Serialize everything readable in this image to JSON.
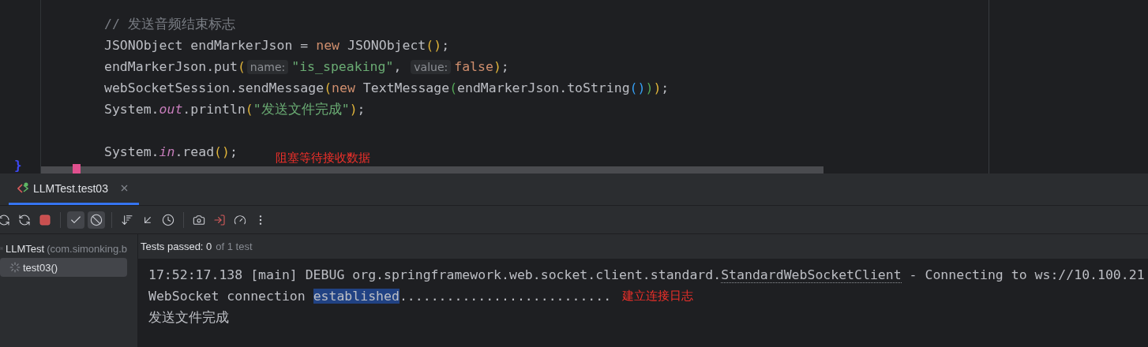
{
  "editor": {
    "gutter_brace": "}",
    "code_lines": [
      {
        "kind": "code",
        "tokens": [
          {
            "kind": "comment",
            "text": "// 发送音频结束标志"
          }
        ]
      },
      {
        "kind": "code",
        "tokens": [
          {
            "kind": "plain",
            "text": "JSONObject endMarkerJson = "
          },
          {
            "kind": "keyword",
            "text": "new"
          },
          {
            "kind": "plain",
            "text": " JSONObject"
          },
          {
            "kind": "paren1",
            "text": "()"
          },
          {
            "kind": "plain",
            "text": ";"
          }
        ]
      },
      {
        "kind": "code",
        "tokens": [
          {
            "kind": "plain",
            "text": "endMarkerJson.put"
          },
          {
            "kind": "paren1",
            "text": "("
          },
          {
            "kind": "hint",
            "text": "name:"
          },
          {
            "kind": "string",
            "text": "\"is_speaking\""
          },
          {
            "kind": "plain",
            "text": ", "
          },
          {
            "kind": "hint",
            "text": "value:"
          },
          {
            "kind": "keyword",
            "text": "false"
          },
          {
            "kind": "paren1",
            "text": ")"
          },
          {
            "kind": "plain",
            "text": ";"
          }
        ]
      },
      {
        "kind": "code",
        "tokens": [
          {
            "kind": "plain",
            "text": "webSocketSession.sendMessage"
          },
          {
            "kind": "paren1",
            "text": "("
          },
          {
            "kind": "keyword",
            "text": "new"
          },
          {
            "kind": "plain",
            "text": " TextMessage"
          },
          {
            "kind": "paren2",
            "text": "("
          },
          {
            "kind": "plain",
            "text": "endMarkerJson.toString"
          },
          {
            "kind": "paren3",
            "text": "()"
          },
          {
            "kind": "paren2",
            "text": ")"
          },
          {
            "kind": "paren1",
            "text": ")"
          },
          {
            "kind": "plain",
            "text": ";"
          }
        ]
      },
      {
        "kind": "code",
        "tokens": [
          {
            "kind": "plain",
            "text": "System."
          },
          {
            "kind": "field",
            "text": "out"
          },
          {
            "kind": "plain",
            "text": ".println"
          },
          {
            "kind": "paren1",
            "text": "("
          },
          {
            "kind": "string",
            "text": "\"发送文件完成\""
          },
          {
            "kind": "paren1",
            "text": ")"
          },
          {
            "kind": "plain",
            "text": ";"
          }
        ]
      },
      {
        "kind": "blank"
      },
      {
        "kind": "code",
        "tokens": [
          {
            "kind": "plain",
            "text": "System."
          },
          {
            "kind": "field",
            "text": "in"
          },
          {
            "kind": "plain",
            "text": ".read"
          },
          {
            "kind": "paren1",
            "text": "()"
          },
          {
            "kind": "plain",
            "text": ";"
          }
        ],
        "note": "阻塞等待接收数据"
      }
    ]
  },
  "run_panel": {
    "tabs": [
      {
        "label": "LLMTest.test03",
        "selected": true
      }
    ],
    "toolbar": {
      "left": [
        {
          "kind": "rerun-failed"
        },
        {
          "kind": "rerun"
        },
        {
          "kind": "stop"
        }
      ],
      "filters": [
        {
          "kind": "passed",
          "selected": true
        },
        {
          "kind": "ignored",
          "selected": true
        }
      ],
      "right": [
        {
          "kind": "sort"
        },
        {
          "kind": "collapse"
        },
        {
          "kind": "clock"
        },
        {
          "kind": "camera"
        },
        {
          "kind": "import"
        },
        {
          "kind": "gauge"
        },
        {
          "kind": "more"
        }
      ]
    },
    "tree": [
      {
        "label": "LLMTest",
        "detail": "(com.simonking.b",
        "selected": false,
        "children": [
          {
            "label": "test03()",
            "selected": true
          }
        ]
      }
    ],
    "status": {
      "passed": "Tests passed: 0",
      "total": "of 1 test"
    },
    "console": [
      {
        "segments": [
          {
            "kind": "plain",
            "text": "17:52:17.138 [main] DEBUG org.springframework.web.socket.client.standard."
          },
          {
            "kind": "link",
            "text": "StandardWebSocketClient"
          },
          {
            "kind": "plain",
            "text": " - Connecting to ws://10.100.21"
          }
        ]
      },
      {
        "segments": [
          {
            "kind": "plain",
            "text": "WebSocket connection "
          },
          {
            "kind": "selected",
            "text": "established"
          },
          {
            "kind": "plain",
            "text": "..........................."
          }
        ],
        "note": "建立连接日志"
      },
      {
        "segments": [
          {
            "kind": "plain",
            "text": "发送文件完成"
          }
        ]
      }
    ]
  }
}
